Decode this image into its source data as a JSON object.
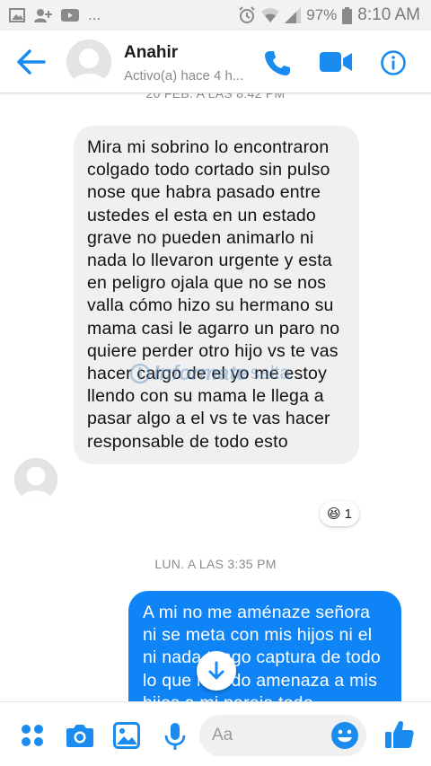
{
  "status_bar": {
    "battery": "97%",
    "time": "8:10 AM",
    "left_overflow": "..."
  },
  "header": {
    "contact_name": "Anahir",
    "contact_status": "Activo(a) hace 4 h..."
  },
  "conversation": {
    "timestamp_top": "20 FEB. A LAS 8:42 PM",
    "incoming_message": "Mira mi sobrino lo encontraron colgado todo cortado sin pulso nose que habra pasado entre ustedes el esta en un estado grave no pueden animarlo ni nada lo llevaron urgente y esta en peligro ojala que no se nos valla cómo hizo su hermano su mama casi le agarro un paro no quiere perder otro hijo vs te vas hacer cargo de el yo me estoy llendo con su mama le llega a pasar algo a el vs te vas hacer responsable de todo esto",
    "reaction": {
      "emoji": "😆",
      "count": "1"
    },
    "timestamp_mid": "LUN. A LAS 3:35 PM",
    "outgoing_message": "A mi no me aménaze señora ni se meta con mis hijos ni el ni nada tengo captura de todo lo que mando amenaza a mis hijos a mi pareja todo"
  },
  "watermark": {
    "main": "Informate",
    "sub": "salta"
  },
  "composer": {
    "placeholder": "Aa"
  },
  "colors": {
    "messenger_blue": "#0f84f7",
    "incoming_bubble": "#f0f0f0",
    "icon_blue": "#1a8cf0"
  },
  "icons": [
    "back-arrow-icon",
    "phone-icon",
    "video-icon",
    "info-icon",
    "apps-icon",
    "camera-icon",
    "gallery-icon",
    "microphone-icon",
    "emoji-icon",
    "like-icon",
    "arrow-down-icon"
  ]
}
